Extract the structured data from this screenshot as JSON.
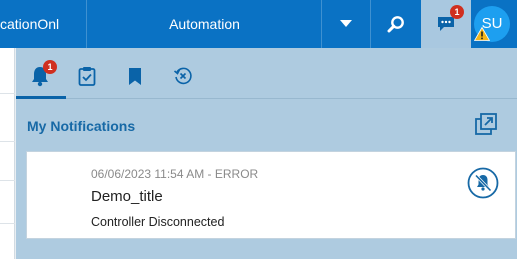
{
  "topbar": {
    "app_title": "cationOnl",
    "center_label": "Automation",
    "chat_badge": "1",
    "user_initials": "SU"
  },
  "tabs": {
    "notifications_badge": "1",
    "items": [
      "bell-icon",
      "clipboard-check-icon",
      "bookmark-icon",
      "history-clear-icon"
    ]
  },
  "notifications": {
    "section_title": "My Notifications",
    "items": [
      {
        "meta": "06/06/2023 11:54 AM - ERROR",
        "title": "Demo_title",
        "message": "Controller Disconnected"
      }
    ]
  },
  "colors": {
    "topbar": "#0a72c4",
    "panel": "#aecbe0",
    "accent": "#1769a6",
    "badge": "#d02f1f",
    "avatar": "#1d9ff0"
  }
}
